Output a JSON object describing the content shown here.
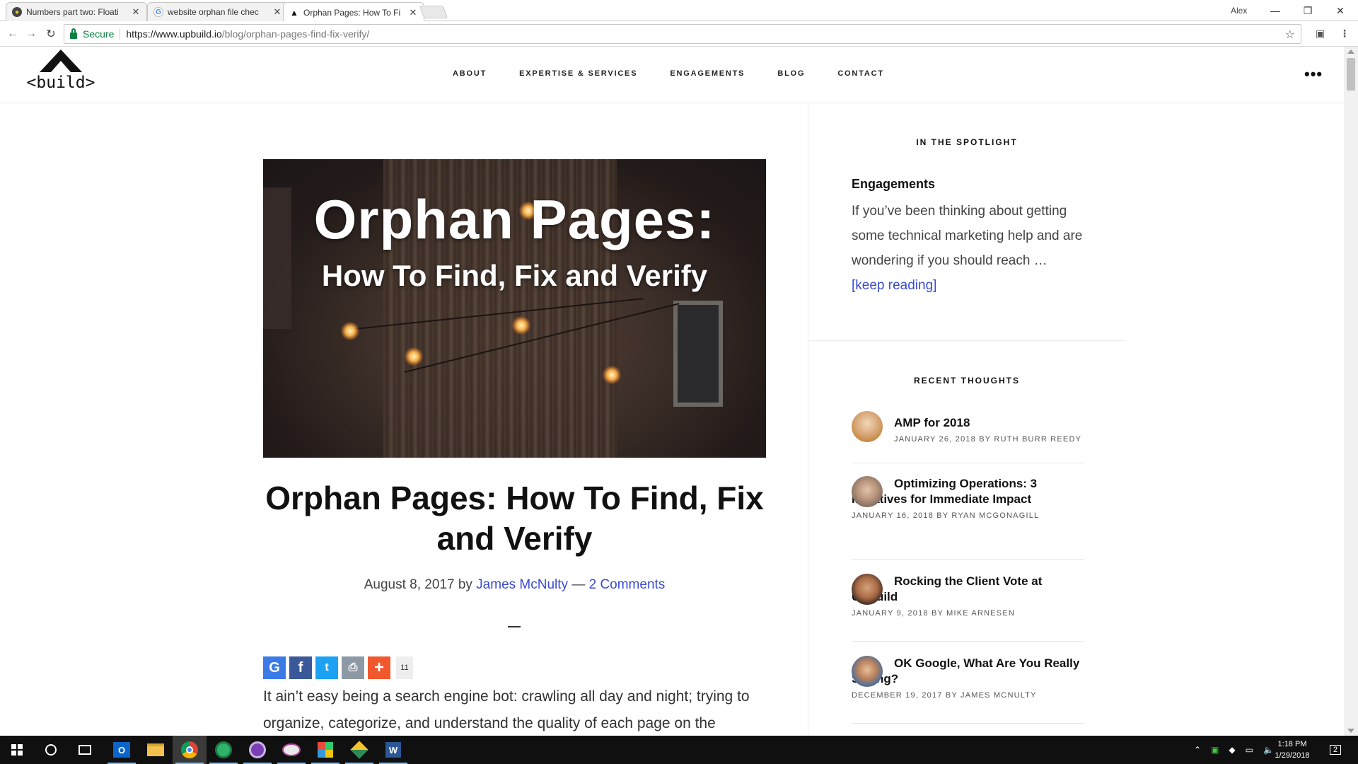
{
  "browser": {
    "tabs": [
      {
        "title": "Numbers part two: Floati",
        "icon": "bookmark-circle-icon"
      },
      {
        "title": "website orphan file chec",
        "icon": "google-g-icon"
      },
      {
        "title": "Orphan Pages: How To Fi",
        "icon": "upbuild-roof-icon"
      }
    ],
    "profile_name": "Alex",
    "secure_label": "Secure",
    "url_host": "https://www.upbuild.io",
    "url_path": "/blog/orphan-pages-find-fix-verify/"
  },
  "site": {
    "logo_text": "<build>",
    "nav": [
      "ABOUT",
      "EXPERTISE & SERVICES",
      "ENGAGEMENTS",
      "BLOG",
      "CONTACT"
    ],
    "more_icon": "more-horizontal-icon"
  },
  "article": {
    "hero_title": "Orphan Pages:",
    "hero_subtitle": "How To Find, Fix and Verify",
    "title": "Orphan Pages: How To Find, Fix and Verify",
    "date": "August 8, 2017",
    "by": "by",
    "author": "James McNulty",
    "dash": "—",
    "comments": "2 Comments",
    "share_count": "11",
    "body": "It ain’t easy being a search engine bot: crawling all day and night; trying to organize, categorize, and understand the quality of each page on the"
  },
  "sidebar": {
    "spotlight_heading": "IN THE SPOTLIGHT",
    "spotlight_title": "Engagements",
    "spotlight_text": "If you’ve been thinking about getting some technical marketing help and are wondering if you should reach …",
    "keep_reading": "[keep reading]",
    "recent_heading": "RECENT THOUGHTS",
    "recent": [
      {
        "title": "AMP for 2018",
        "meta": "JANUARY 26, 2018 BY RUTH BURR REEDY"
      },
      {
        "title": "Optimizing Operations: 3 Initiatives for Immediate Impact",
        "meta": "JANUARY 16, 2018 BY RYAN MCGONAGILL"
      },
      {
        "title": "Rocking the Client Vote at UpBuild",
        "meta": "JANUARY 9, 2018 BY MIKE ARNESEN"
      },
      {
        "title": "OK Google, What Are You Really Saying?",
        "meta": "DECEMBER 19, 2017 BY JAMES MCNULTY"
      }
    ]
  },
  "taskbar": {
    "time": "1:18 PM",
    "date": "1/29/2018",
    "notification_count": "2"
  },
  "colors": {
    "link": "#3a4bd3",
    "secure_green": "#0b8043",
    "taskbar": "#101010",
    "share_google": "#3a7be8",
    "share_facebook": "#3b5998",
    "share_twitter": "#1da1f2",
    "share_print": "#8d9aa5",
    "share_more": "#f1582d"
  }
}
